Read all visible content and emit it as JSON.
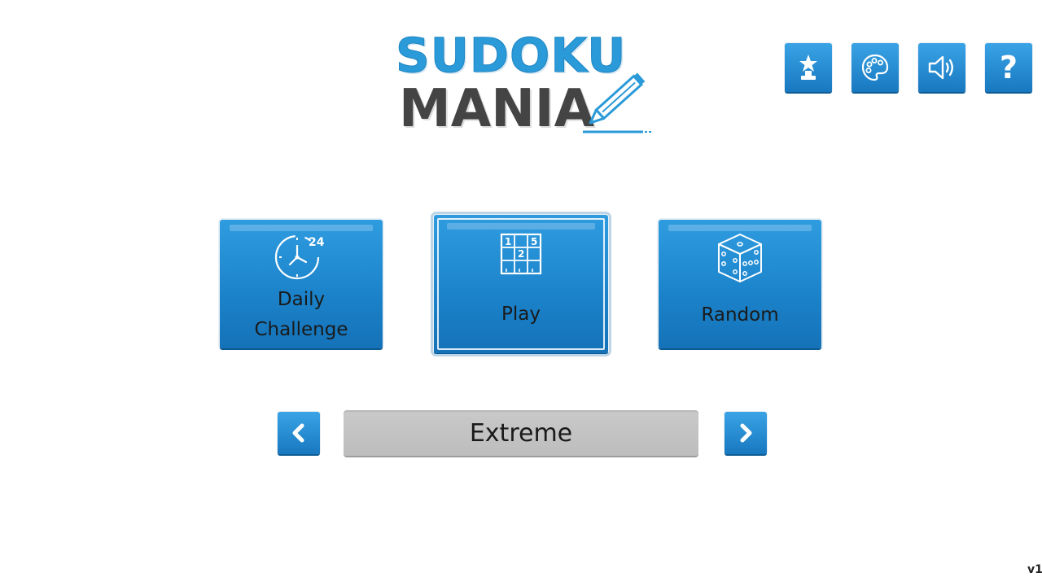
{
  "logo": {
    "line1": "SUDOKU",
    "line2": "MANIA"
  },
  "top_icons": [
    {
      "name": "achievements-icon"
    },
    {
      "name": "theme-palette-icon"
    },
    {
      "name": "sound-icon"
    },
    {
      "name": "help-icon",
      "glyph": "?"
    }
  ],
  "modes": {
    "daily": {
      "label_line1": "Daily",
      "label_line2": "Challenge",
      "clock_badge": "24"
    },
    "play": {
      "label": "Play",
      "grid_digits": [
        "1",
        "5",
        "2"
      ]
    },
    "random": {
      "label": "Random"
    }
  },
  "difficulty": {
    "current": "Extreme"
  },
  "version": "v1.",
  "colors": {
    "accent_blue": "#1b82c9",
    "logo_blue": "#2a9ad8",
    "logo_dark": "#444444",
    "selector_gray": "#c4c4c4"
  }
}
